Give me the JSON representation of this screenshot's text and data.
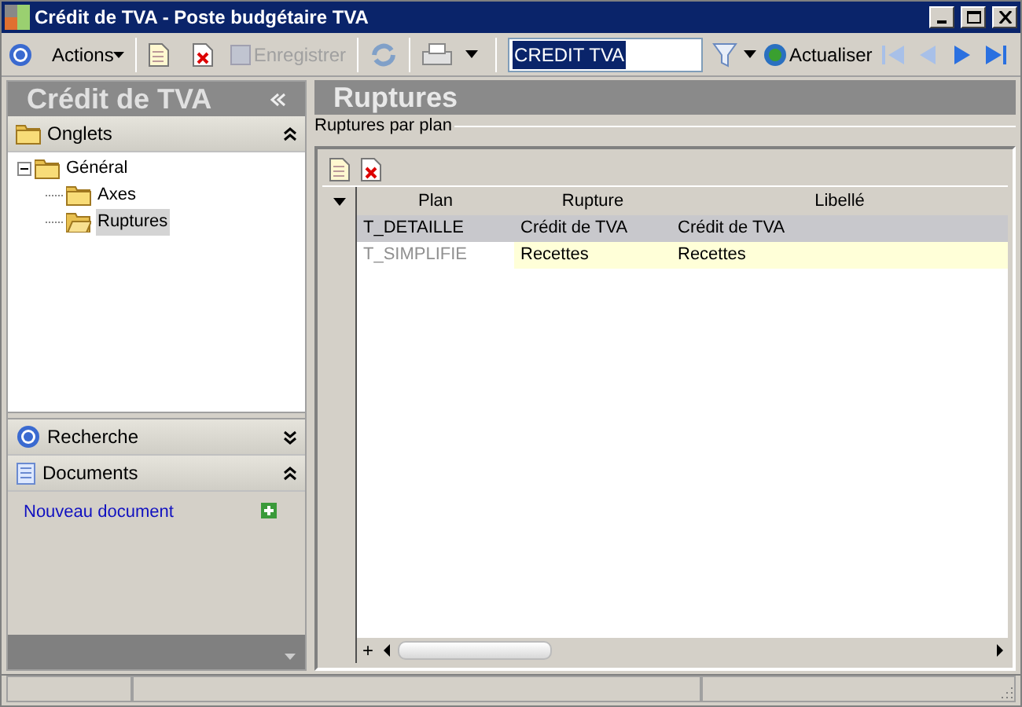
{
  "window": {
    "title": "Crédit de TVA -  Poste budgétaire TVA"
  },
  "toolbar": {
    "actions": "Actions",
    "save": "Enregistrer",
    "search_value": "CREDIT TVA",
    "refresh": "Actualiser"
  },
  "sidebar": {
    "title": "Crédit de TVA",
    "sections": [
      {
        "kind": "tree",
        "label": "Onglets",
        "expanded": true,
        "tree": [
          {
            "label": "Général",
            "expanded": true,
            "selected": false,
            "children": [
              {
                "label": "Axes",
                "selected": false
              },
              {
                "label": "Ruptures",
                "selected": true
              }
            ]
          }
        ]
      },
      {
        "kind": "search",
        "label": "Recherche",
        "expanded": false
      },
      {
        "kind": "documents",
        "label": "Documents",
        "expanded": true,
        "link": "Nouveau document"
      }
    ]
  },
  "main": {
    "title": "Ruptures",
    "group_label": "Ruptures par plan",
    "table": {
      "columns": [
        "Plan",
        "Rupture",
        "Libellé"
      ],
      "rows": [
        {
          "cells": [
            "T_DETAILLE",
            "Crédit de TVA",
            "Crédit de TVA"
          ],
          "selected": true,
          "highlighted": false
        },
        {
          "cells": [
            "T_SIMPLIFIE",
            "Recettes",
            "Recettes"
          ],
          "selected": false,
          "highlighted": true
        }
      ],
      "add_row": "+"
    }
  }
}
